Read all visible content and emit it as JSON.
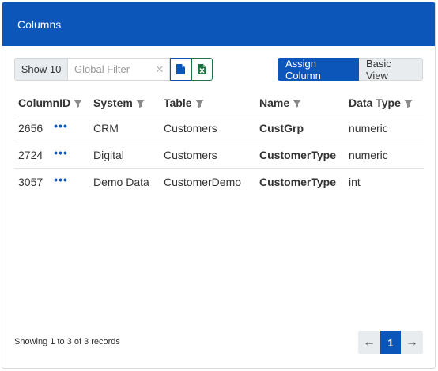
{
  "panel": {
    "title": "Columns"
  },
  "toolbar": {
    "show_label": "Show 10",
    "filter_placeholder": "Global Filter",
    "clear_glyph": "✕",
    "export_csv_icon": "file-icon",
    "export_excel_icon": "excel-icon",
    "assign_label": "Assign Column",
    "basic_view_label": "Basic View"
  },
  "table": {
    "headers": {
      "column_id": "ColumnID",
      "system": "System",
      "table": "Table",
      "name": "Name",
      "data_type": "Data Type"
    },
    "rows": [
      {
        "column_id": "2656",
        "actions": "•••",
        "system": "CRM",
        "table": "Customers",
        "name": "CustGrp",
        "data_type": "numeric"
      },
      {
        "column_id": "2724",
        "actions": "•••",
        "system": "Digital",
        "table": "Customers",
        "name": "CustomerType",
        "data_type": "numeric"
      },
      {
        "column_id": "3057",
        "actions": "•••",
        "system": "Demo Data",
        "table": "CustomerDemo",
        "name": "CustomerType",
        "data_type": "int"
      }
    ]
  },
  "footer": {
    "info": "Showing 1 to 3 of 3 records",
    "prev_glyph": "←",
    "current_page": "1",
    "next_glyph": "→"
  },
  "colors": {
    "primary": "#0b56b8",
    "excel": "#217346",
    "button_bg": "#e9ecef"
  }
}
